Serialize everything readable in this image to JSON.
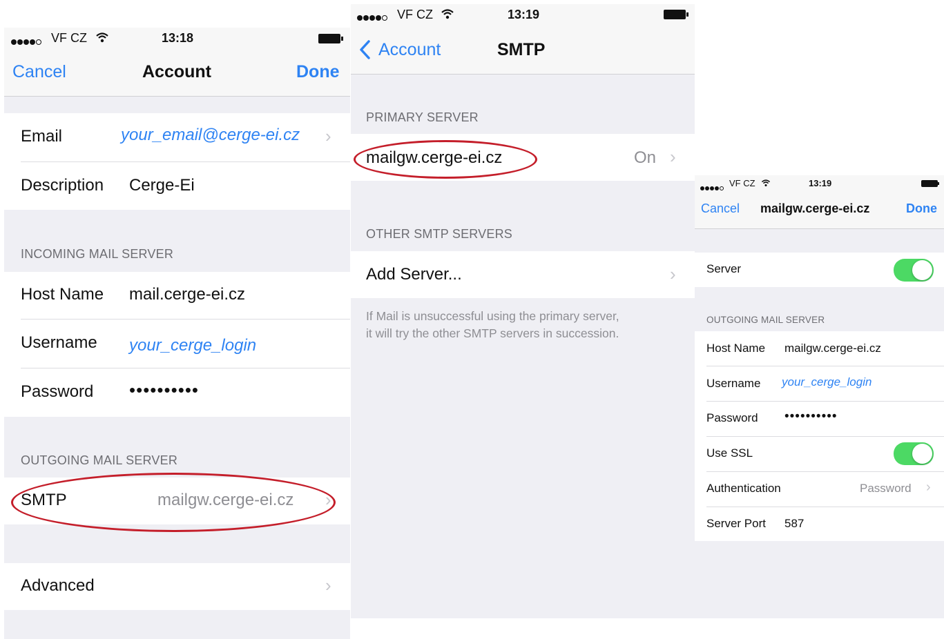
{
  "panel1": {
    "status": {
      "carrier": "VF CZ",
      "time": "13:18"
    },
    "nav": {
      "cancel": "Cancel",
      "title": "Account",
      "done": "Done"
    },
    "email": {
      "label": "Email",
      "value": "your_email@cerge-ei.cz"
    },
    "description": {
      "label": "Description",
      "value": "Cerge-Ei"
    },
    "incoming_header": "INCOMING MAIL SERVER",
    "host": {
      "label": "Host Name",
      "value": "mail.cerge-ei.cz"
    },
    "username": {
      "label": "Username",
      "value": "your_cerge_login"
    },
    "password": {
      "label": "Password",
      "value": "••••••••••"
    },
    "outgoing_header": "OUTGOING MAIL SERVER",
    "smtp": {
      "label": "SMTP",
      "value": "mailgw.cerge-ei.cz"
    },
    "advanced": {
      "label": "Advanced"
    }
  },
  "panel2": {
    "status": {
      "carrier": "VF CZ",
      "time": "13:19"
    },
    "nav": {
      "back": "Account",
      "title": "SMTP"
    },
    "primary_header": "PRIMARY SERVER",
    "primary": {
      "label": "mailgw.cerge-ei.cz",
      "value": "On"
    },
    "other_header": "OTHER SMTP SERVERS",
    "add_server": "Add Server...",
    "footer_line1": "If Mail is unsuccessful using the primary server,",
    "footer_line2": "it will try the other SMTP servers in succession."
  },
  "panel3": {
    "status": {
      "carrier": "VF CZ",
      "time": "13:19"
    },
    "nav": {
      "cancel": "Cancel",
      "title": "mailgw.cerge-ei.cz",
      "done": "Done"
    },
    "server": {
      "label": "Server",
      "on": true
    },
    "outgoing_header": "OUTGOING MAIL SERVER",
    "host": {
      "label": "Host Name",
      "value": "mailgw.cerge-ei.cz"
    },
    "username": {
      "label": "Username",
      "value": "your_cerge_login"
    },
    "password": {
      "label": "Password",
      "value": "••••••••••"
    },
    "ssl": {
      "label": "Use SSL",
      "on": true
    },
    "auth": {
      "label": "Authentication",
      "value": "Password"
    },
    "port": {
      "label": "Server Port",
      "value": "587"
    }
  },
  "icons": {
    "chevron": "chevron-right-icon",
    "back": "chevron-left-icon",
    "signal": "signal-dots-icon",
    "wifi": "wifi-icon",
    "battery": "battery-icon"
  },
  "colors": {
    "accent": "#2e83f3",
    "toggle_on": "#4cd964",
    "highlight_ring": "#c41e2a",
    "group_bg": "#efeff4"
  }
}
